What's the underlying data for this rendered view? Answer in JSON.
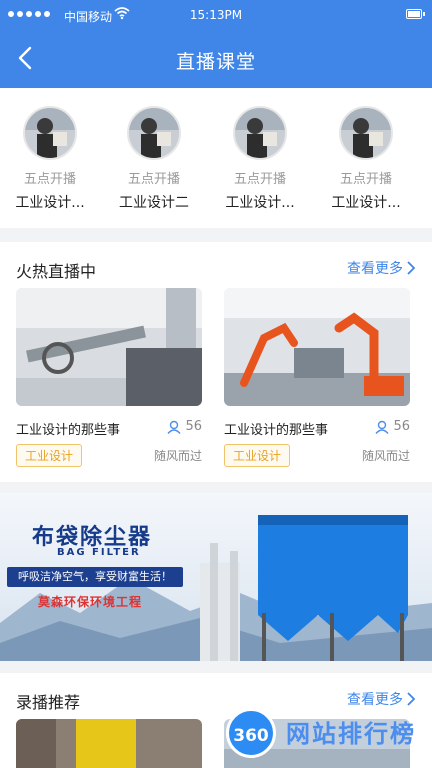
{
  "status_bar": {
    "carrier": "中国移动",
    "time": "15:13PM"
  },
  "header": {
    "title": "直播课堂"
  },
  "teachers": [
    {
      "time": "五点开播",
      "name": "工业设计..."
    },
    {
      "time": "五点开播",
      "name": "工业设计二"
    },
    {
      "time": "五点开播",
      "name": "工业设计..."
    },
    {
      "time": "五点开播",
      "name": "工业设计..."
    }
  ],
  "hot_live": {
    "title": "火热直播中",
    "more": "查看更多",
    "cards": [
      {
        "title": "工业设计的那些事",
        "views": "56",
        "tag": "工业设计",
        "author": "随风而过"
      },
      {
        "title": "工业设计的那些事",
        "views": "56",
        "tag": "工业设计",
        "author": "随风而过"
      }
    ]
  },
  "banner": {
    "title": "布袋除尘器",
    "subtitle": "BAG FILTER",
    "slogan": "呼吸洁净空气，享受财富生活！",
    "company": "莫森环保环境工程"
  },
  "recorded": {
    "title": "录播推荐",
    "more": "查看更多"
  },
  "watermark": {
    "logo": "360",
    "text": "网站排行榜"
  },
  "colors": {
    "primary": "#3f86e8",
    "tag": "#e7a21a"
  }
}
